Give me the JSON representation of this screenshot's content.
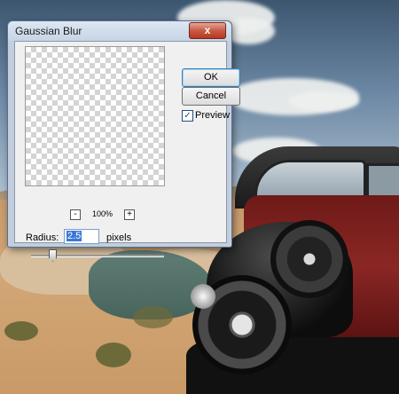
{
  "dialog": {
    "title": "Gaussian Blur",
    "close_glyph": "x",
    "ok_label": "OK",
    "cancel_label": "Cancel",
    "preview_label": "Preview",
    "preview_checked": true,
    "zoom_level": "100%",
    "zoom_out_glyph": "-",
    "zoom_in_glyph": "+",
    "radius_label": "Radius:",
    "radius_value": "2.5",
    "radius_unit": "pixels"
  },
  "icons": {
    "close": "close-icon",
    "zoom_out": "minus-icon",
    "zoom_in": "plus-icon",
    "check": "checkmark-icon"
  },
  "colors": {
    "selection": "#3a78d6",
    "close_button": "#c85b45"
  }
}
